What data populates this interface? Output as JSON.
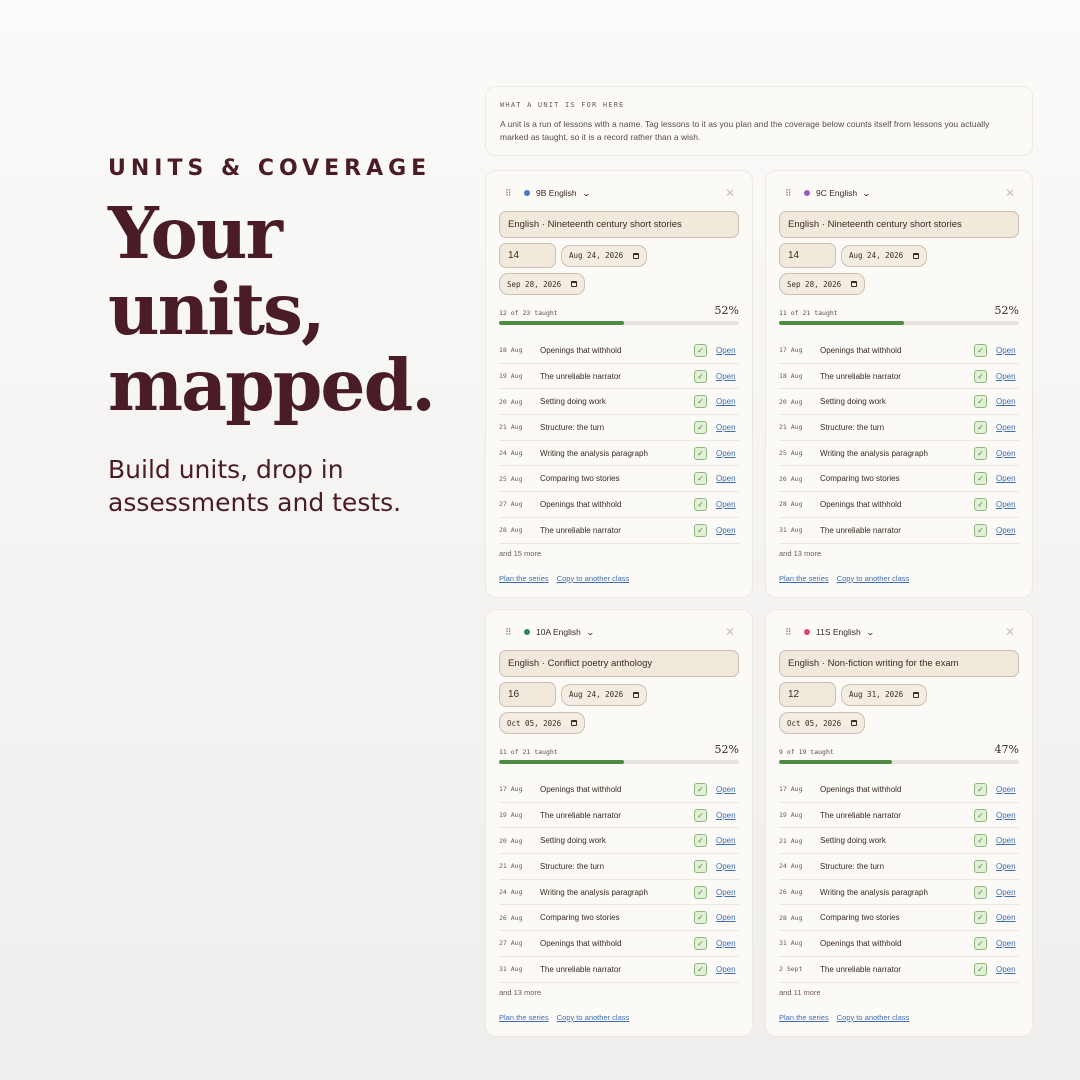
{
  "hero": {
    "eyebrow": "UNITS & COVERAGE",
    "headline": [
      "Your",
      "units,",
      "mapped."
    ],
    "subline": "Build units, drop in assessments and tests."
  },
  "info": {
    "title": "WHAT A UNIT IS FOR HERE",
    "body": "A unit is a run of lessons with a name. Tag lessons to it as you plan and the coverage below counts itself from lessons you actually marked as taught, so it is a record rather than a wish."
  },
  "cards": [
    {
      "class_name": "9B English",
      "dot_color": "#4a78c4",
      "unit_title": "English · Nineteenth century short stories",
      "lesson_count": "14",
      "start_date": "Aug 24, 2026",
      "end_date": "Sep 28, 2026",
      "progress_text": "12 of 23 taught",
      "progress_pct": "52%",
      "progress": 0.52,
      "lessons": [
        {
          "date": "18 Aug",
          "title": "Openings that withhold"
        },
        {
          "date": "19 Aug",
          "title": "The unreliable narrator"
        },
        {
          "date": "20 Aug",
          "title": "Setting doing work"
        },
        {
          "date": "21 Aug",
          "title": "Structure: the turn"
        },
        {
          "date": "24 Aug",
          "title": "Writing the analysis paragraph"
        },
        {
          "date": "25 Aug",
          "title": "Comparing two stories"
        },
        {
          "date": "27 Aug",
          "title": "Openings that withhold"
        },
        {
          "date": "28 Aug",
          "title": "The unreliable narrator"
        }
      ],
      "more": "and 15 more"
    },
    {
      "class_name": "9C English",
      "dot_color": "#9a5cc0",
      "unit_title": "English · Nineteenth century short stories",
      "lesson_count": "14",
      "start_date": "Aug 24, 2026",
      "end_date": "Sep 28, 2026",
      "progress_text": "11 of 21 taught",
      "progress_pct": "52%",
      "progress": 0.52,
      "lessons": [
        {
          "date": "17 Aug",
          "title": "Openings that withhold"
        },
        {
          "date": "18 Aug",
          "title": "The unreliable narrator"
        },
        {
          "date": "20 Aug",
          "title": "Setting doing work"
        },
        {
          "date": "21 Aug",
          "title": "Structure: the turn"
        },
        {
          "date": "25 Aug",
          "title": "Writing the analysis paragraph"
        },
        {
          "date": "26 Aug",
          "title": "Comparing two stories"
        },
        {
          "date": "28 Aug",
          "title": "Openings that withhold"
        },
        {
          "date": "31 Aug",
          "title": "The unreliable narrator"
        }
      ],
      "more": "and 13 more"
    },
    {
      "class_name": "10A English",
      "dot_color": "#2f7f6b",
      "unit_title": "English · Conflict poetry anthology",
      "lesson_count": "16",
      "start_date": "Aug 24, 2026",
      "end_date": "Oct 05, 2026",
      "progress_text": "11 of 21 taught",
      "progress_pct": "52%",
      "progress": 0.52,
      "lessons": [
        {
          "date": "17 Aug",
          "title": "Openings that withhold"
        },
        {
          "date": "19 Aug",
          "title": "The unreliable narrator"
        },
        {
          "date": "20 Aug",
          "title": "Setting doing work"
        },
        {
          "date": "21 Aug",
          "title": "Structure: the turn"
        },
        {
          "date": "24 Aug",
          "title": "Writing the analysis paragraph"
        },
        {
          "date": "26 Aug",
          "title": "Comparing two stories"
        },
        {
          "date": "27 Aug",
          "title": "Openings that withhold"
        },
        {
          "date": "31 Aug",
          "title": "The unreliable narrator"
        }
      ],
      "more": "and 13 more"
    },
    {
      "class_name": "11S English",
      "dot_color": "#d4457f",
      "unit_title": "English · Non-fiction writing for the exam",
      "lesson_count": "12",
      "start_date": "Aug 31, 2026",
      "end_date": "Oct 05, 2026",
      "progress_text": "9 of 19 taught",
      "progress_pct": "47%",
      "progress": 0.47,
      "lessons": [
        {
          "date": "17 Aug",
          "title": "Openings that withhold"
        },
        {
          "date": "19 Aug",
          "title": "The unreliable narrator"
        },
        {
          "date": "21 Aug",
          "title": "Setting doing work"
        },
        {
          "date": "24 Aug",
          "title": "Structure: the turn"
        },
        {
          "date": "26 Aug",
          "title": "Writing the analysis paragraph"
        },
        {
          "date": "28 Aug",
          "title": "Comparing two stories"
        },
        {
          "date": "31 Aug",
          "title": "Openings that withhold"
        },
        {
          "date": "2 Sept",
          "title": "The unreliable narrator"
        }
      ],
      "more": "and 11 more"
    }
  ],
  "labels": {
    "open": "Open",
    "plan_series": "Plan the series",
    "copy_class": "Copy to another class",
    "check_glyph": "✓",
    "grip_glyph": "⠿",
    "close_glyph": "✕",
    "chevron_glyph": "⌄"
  }
}
